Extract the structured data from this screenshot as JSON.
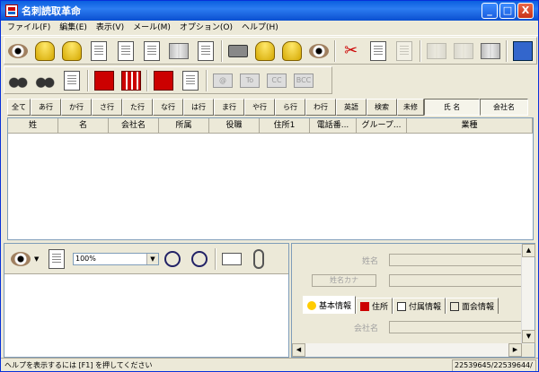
{
  "window": {
    "title": "名刺読取革命",
    "min": "_",
    "max": "□",
    "close": "X"
  },
  "menu": [
    "ファイル(F)",
    "編集(E)",
    "表示(V)",
    "メール(M)",
    "オプション(O)",
    "ヘルプ(H)"
  ],
  "toolbar1_icons": [
    "scan-card-icon",
    "database-icon",
    "folder-open-icon",
    "card-edit-icon",
    "card-import-icon",
    "card-export-icon",
    "address-book-icon",
    "card-transfer-icon",
    "printer-icon",
    "database-add-icon",
    "database-delete-icon",
    "scan-view-icon",
    "cut-icon",
    "copy-icon",
    "paste-icon",
    "book-icon",
    "book-open-icon",
    "book-edit-icon",
    "table-icon"
  ],
  "toolbar2_labels": {
    "to": "To",
    "cc": "CC",
    "bcc": "BCC",
    "at": "@"
  },
  "alpha_tabs": [
    "全て",
    "あ行",
    "か行",
    "さ行",
    "た行",
    "な行",
    "は行",
    "ま行",
    "や行",
    "ら行",
    "わ行",
    "英語",
    "検索",
    "未修"
  ],
  "name_fields": [
    "氏 名",
    "会社名"
  ],
  "columns": [
    "姓",
    "名",
    "会社名",
    "所属",
    "役職",
    "住所1",
    "電話番...",
    "グループ...",
    "業種"
  ],
  "zoom": {
    "value": "100%",
    "arrow": "▼"
  },
  "detail": {
    "name_label": "姓名",
    "kana_button": "姓名カナ",
    "company_label": "会社名",
    "tabs": [
      "基本情報",
      "住所",
      "付属情報",
      "面会情報"
    ]
  },
  "scroll": {
    "up": "▲",
    "down": "▼",
    "left": "◀",
    "right": "▶"
  },
  "status": {
    "message": "ヘルプを表示するには [F1] を押してください",
    "count": "22539645/22539644/"
  },
  "colors": {
    "titlebar": "#0a5fe0",
    "face": "#ece9d8",
    "border": "#7f9db9"
  }
}
